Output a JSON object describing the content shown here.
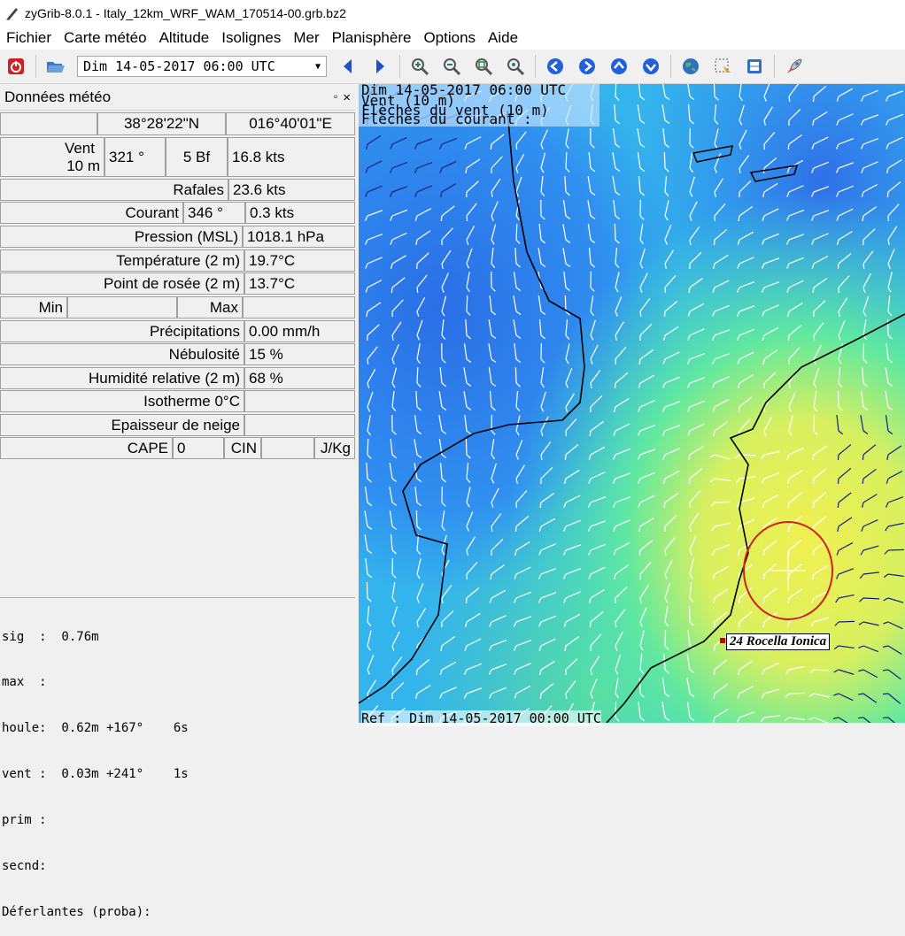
{
  "window": {
    "title": "zyGrib-8.0.1 - Italy_12km_WRF_WAM_170514-00.grb.bz2"
  },
  "menu": [
    "Fichier",
    "Carte météo",
    "Altitude",
    "Isolignes",
    "Mer",
    "Planisphère",
    "Options",
    "Aide"
  ],
  "toolbar": {
    "date_value": "Dim 14-05-2017 06:00 UTC",
    "icons": [
      "quit-icon",
      "open-icon",
      "prev-date-icon",
      "next-date-icon",
      "zoom-in-icon",
      "zoom-out-icon",
      "zoom-fit-icon",
      "zoom-all-icon",
      "pan-left-icon",
      "pan-right-icon",
      "pan-up-icon",
      "pan-down-icon",
      "globe-icon",
      "select-zone-icon",
      "meteotable-icon",
      "rocket-icon"
    ],
    "colors": {
      "quit": "#d02020",
      "nav": "#1e50c8"
    }
  },
  "panel": {
    "title": "Données météo",
    "float_btn": "▫",
    "close_btn": "×",
    "lat": "38°28'22\"N",
    "lon": "016°40'01\"E",
    "wind_label_1": "Vent",
    "wind_label_2": "10 m",
    "wind_dir": "321 °",
    "wind_bf": "5 Bf",
    "wind_kts": "16.8  kts",
    "gust_label": "Rafales",
    "gust_value": "23.6  kts",
    "current_label": "Courant",
    "current_dir": "346 °",
    "current_speed": "0.3  kts",
    "pressure_label": "Pression (MSL)",
    "pressure_value": "1018.1 hPa",
    "temp_label": "Température (2 m)",
    "temp_value": "19.7°C",
    "dew_label": "Point de rosée (2 m)",
    "dew_value": "13.7°C",
    "min_label": "Min",
    "max_label": "Max",
    "precip_label": "Précipitations",
    "precip_value": "0.00 mm/h",
    "cloud_label": "Nébulosité",
    "cloud_value": "15 %",
    "humid_label": "Humidité relative (2 m)",
    "humid_value": "68 %",
    "iso_label": "Isotherme 0°C",
    "snow_label": "Epaisseur de neige",
    "cape_label": "CAPE",
    "cape_value": "0",
    "cin_label": "CIN",
    "jkg_label": "J/Kg"
  },
  "waves": {
    "lines": [
      "sig  :  0.76m",
      "max  :",
      "houle:  0.62m +167°    6s",
      "vent :  0.03m +241°    1s",
      "prim :",
      "secnd:",
      "Déferlantes (proba):"
    ]
  },
  "map": {
    "overlay_lines": [
      "Dim 14-05-2017 06:00 UTC",
      "Vent (10 m)",
      "Flèches du vent (10 m)",
      "Flèches du courant :"
    ],
    "ref_text": "Ref : Dim 14-05-2017 00:00 UTC",
    "city": "24 Rocella Ionica",
    "colors": {
      "blue": "#2a6ee6",
      "cyan": "#30c8e8",
      "green": "#40e0a0",
      "yellow": "#f0f050",
      "coast": "#000000",
      "marker": "#d02020"
    }
  }
}
